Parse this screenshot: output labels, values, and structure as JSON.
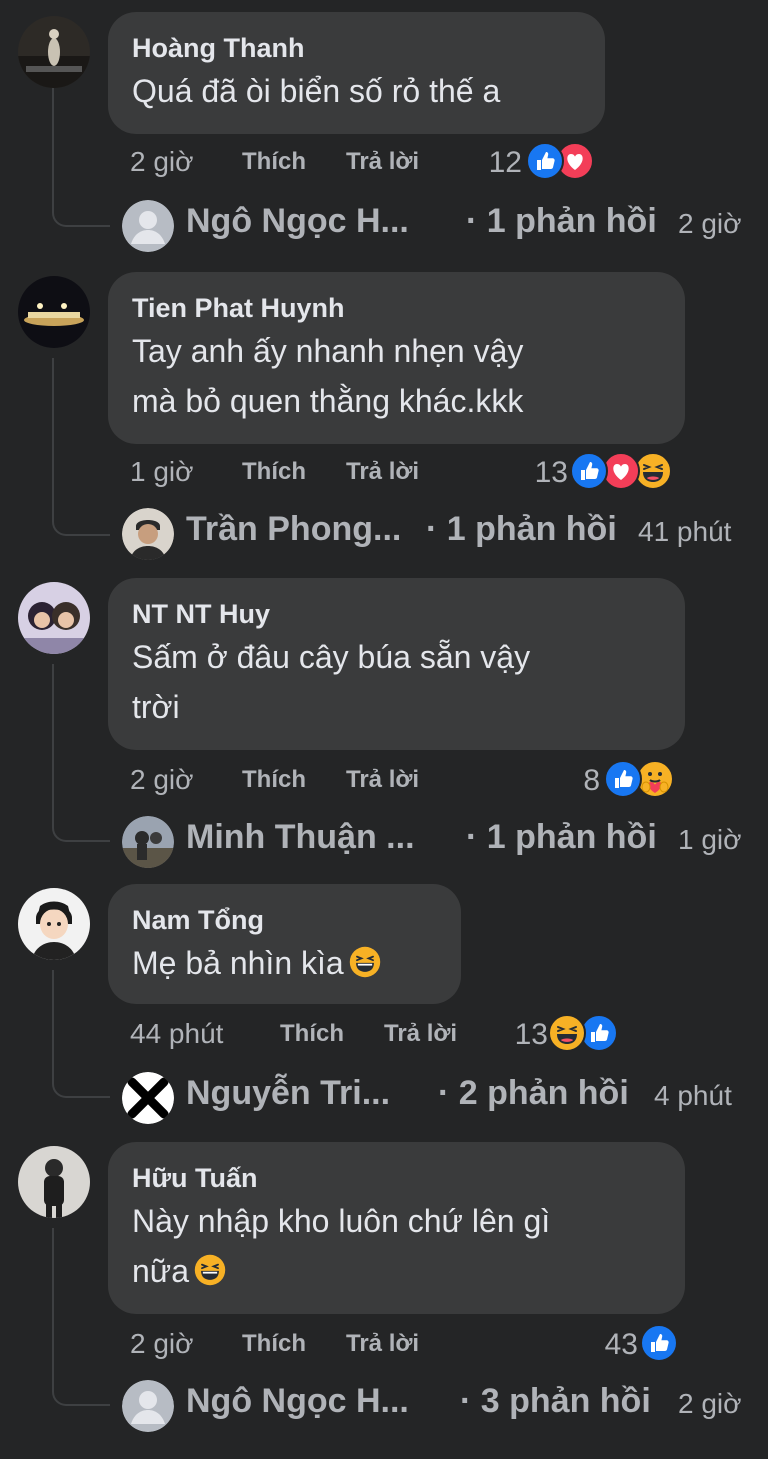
{
  "labels": {
    "like": "Thích",
    "reply": "Trả lời"
  },
  "comments": [
    {
      "author": "Hoàng Thanh",
      "lines": [
        "Quá đã òi biển số rỏ thế a"
      ],
      "time": "2 giờ",
      "reaction_count": "12",
      "reactions": [
        "like-icon",
        "love-icon"
      ],
      "reply_name": "Ngô Ngọc H...",
      "reply_count": "· 1 phản hồi",
      "reply_time": "2 giờ"
    },
    {
      "author": "Tien Phat Huynh",
      "lines": [
        "Tay anh ấy nhanh nhẹn vậy",
        "mà bỏ quen thằng khác.kkk"
      ],
      "time": "1 giờ",
      "reaction_count": "13",
      "reactions": [
        "like-icon",
        "love-icon",
        "haha-icon"
      ],
      "reply_name": "Trần Phong...",
      "reply_count": "· 1 phản hồi",
      "reply_time": "41 phút"
    },
    {
      "author": "NT NT Huy",
      "lines": [
        "Sấm ở đâu cây búa sẵn vậy",
        "trời"
      ],
      "time": "2 giờ",
      "reaction_count": "8",
      "reactions": [
        "like-icon",
        "care-icon"
      ],
      "reply_name": "Minh Thuận ...",
      "reply_count": "· 1 phản hồi",
      "reply_time": "1 giờ"
    },
    {
      "author": "Nam Tổng",
      "lines": [
        "Mẹ bả nhìn kìa"
      ],
      "time": "44 phút",
      "reaction_count": "13",
      "reactions": [
        "haha-icon",
        "like-icon"
      ],
      "reply_name": "Nguyễn Tri...",
      "reply_count": "· 2 phản hồi",
      "reply_time": "4 phút"
    },
    {
      "author": "Hữu Tuấn",
      "lines": [
        "Này nhập kho luôn chứ lên gì",
        "nữa"
      ],
      "time": "2 giờ",
      "reaction_count": "43",
      "reactions": [
        "like-icon"
      ],
      "reply_name": "Ngô Ngọc H...",
      "reply_count": "· 3 phản hồi",
      "reply_time": "2 giờ"
    }
  ]
}
